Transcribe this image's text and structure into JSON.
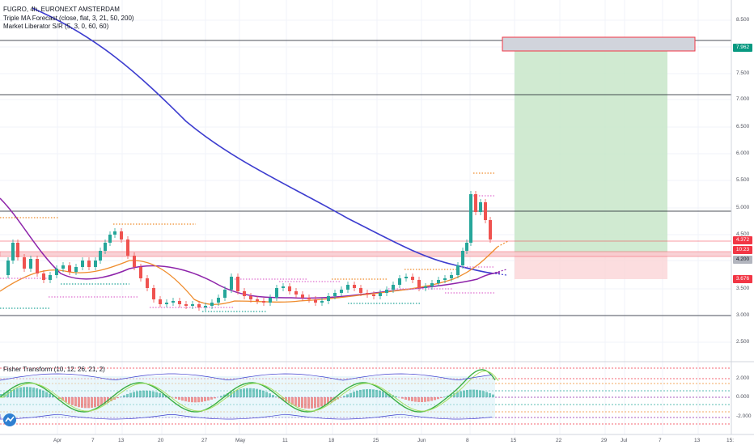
{
  "legend": {
    "title": "FUGRO, 4h, EURONEXT AMSTERDAM",
    "indicator1": "Triple MA Forecast (close, flat, 3, 21, 50, 200)",
    "indicator2": "Market Liberator S/R (5, 3, 0, 60, 60)",
    "oscillator": "Fisher Transform (10, 12, 26, 21, 2)"
  },
  "price_axis": [
    "8.500",
    "8.000",
    "7.500",
    "7.000",
    "6.500",
    "6.000",
    "5.500",
    "5.000",
    "4.500",
    "4.000",
    "3.500",
    "3.000",
    "2.500"
  ],
  "osc_axis": [
    "2.000",
    "0.000",
    "-2.000"
  ],
  "time_axis": [
    "Apr",
    "7",
    "13",
    "20",
    "27",
    "May",
    "11",
    "18",
    "25",
    "Jun",
    "8",
    "15",
    "22",
    "29",
    "Jul",
    "7",
    "13",
    "15:"
  ],
  "price_tags": [
    {
      "label": "7.962",
      "color": "#089981"
    },
    {
      "label": "4.372",
      "color": "#f23645"
    },
    {
      "label": "10:23",
      "color": "#f23645"
    },
    {
      "label": "4.200",
      "color": "#b2b5be"
    },
    {
      "label": "3.676",
      "color": "#f23645"
    }
  ],
  "colors": {
    "ma200": "#3d3dcf",
    "ma50": "#8e24aa",
    "ma21": "#ef8c2c",
    "up": "#26a69a",
    "down": "#ef5350",
    "target_zone": "#c8e6c9",
    "stop_zone": "#fbd5d7"
  },
  "icons": {
    "logo": "tradingview-logo-icon"
  }
}
